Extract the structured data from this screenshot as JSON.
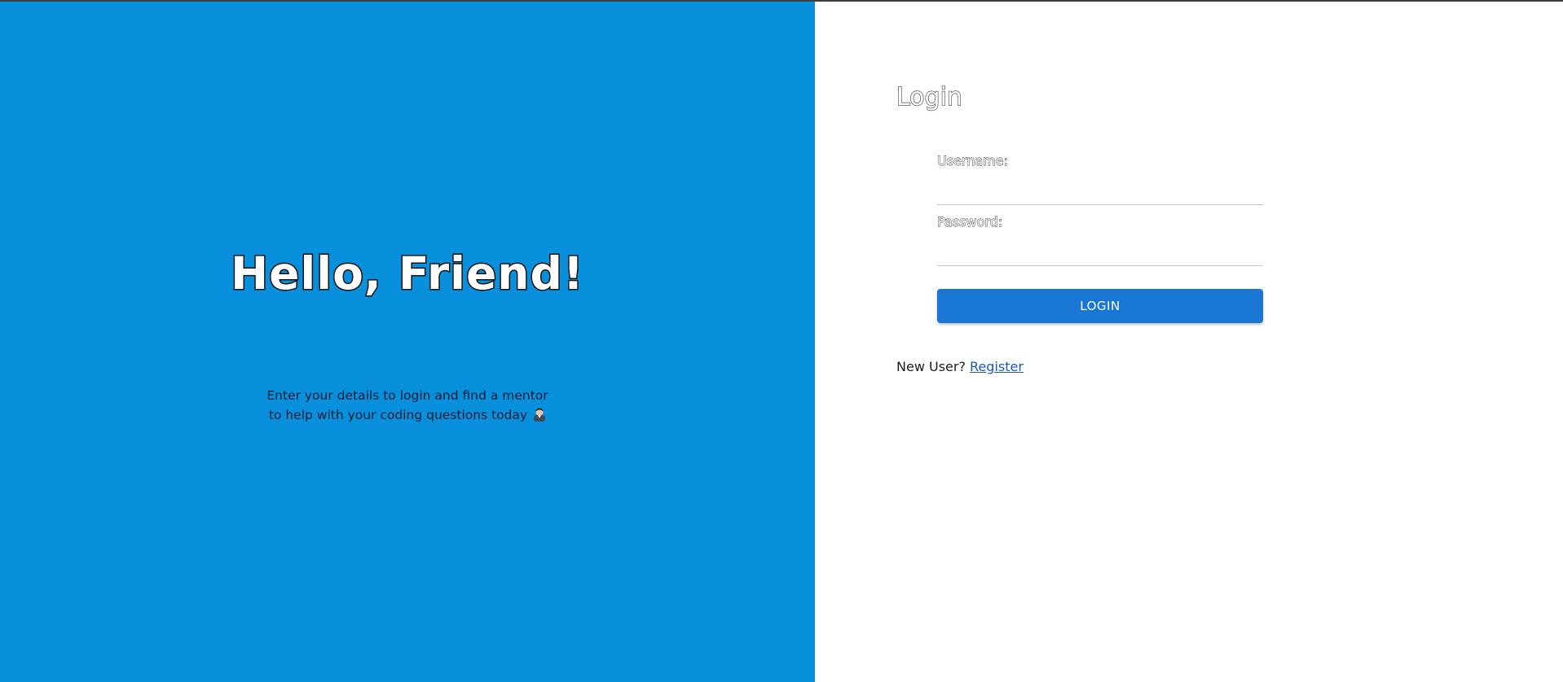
{
  "hero": {
    "title": "Hello, Friend!",
    "subtitle_line1": "Enter your details to login and find a mentor",
    "subtitle_line2": "to help with your coding questions today",
    "emoji_icon": "person-emoji-icon"
  },
  "login": {
    "title": "Login",
    "username_label": "Username:",
    "username_value": "",
    "password_label": "Password:",
    "password_value": "",
    "button_label": "LOGIN",
    "new_user_text": "New User?",
    "register_link": "Register"
  },
  "colors": {
    "left_panel": "#0890dc",
    "button": "#1976d2",
    "link": "#1a56c8"
  }
}
